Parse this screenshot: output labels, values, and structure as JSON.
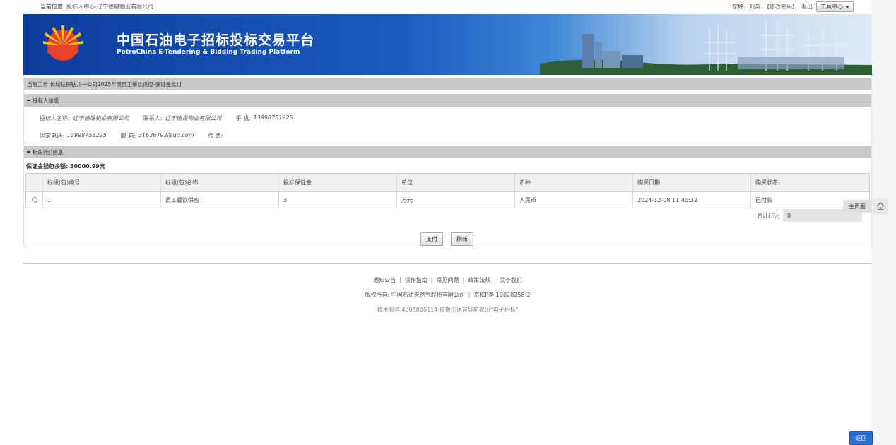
{
  "topbar": {
    "location_label": "当前位置:",
    "location_value": "投标人中心-辽宁德晟物业有限公司",
    "greeting_label": "您好:",
    "user_name": "刘英",
    "change_password": "【修改密码】",
    "logout": "退出",
    "tool_center": "工具中心"
  },
  "banner": {
    "title_cn": "中国石油电子招标投标交易平台",
    "title_en": "PetroChina E-Tendering & Bidding Trading Platform"
  },
  "current_work": {
    "label": "当前工作",
    "value": "长城钻探钻井一公司2025年度员工餐饮供应-保证金支付"
  },
  "bidder_section": {
    "title": "投标人信息",
    "name_label": "投标人名称:",
    "name_value": "辽宁德晟物业有限公司",
    "contact_label": "联系人:",
    "contact_value": "辽宁德晟物业有限公司",
    "mobile_label": "手 机:",
    "mobile_value": "13998751225",
    "phone_label": "固定电话:",
    "phone_value": "13998751225",
    "email_label": "邮 箱:",
    "email_value": "31636792@qq.com",
    "fax_label": "传 真:",
    "fax_value": ""
  },
  "lot_section": {
    "title": "标段(包)信息",
    "balance_text": "保证金钱包余额: 30000.99元",
    "columns": [
      "标段(包)编号",
      "标段(包)名称",
      "投标保证金",
      "单位",
      "币种",
      "购买日期",
      "购买状态"
    ],
    "rows": [
      [
        "1",
        "员工餐饮供应",
        "3",
        "万元",
        "人民币",
        "2024-12-08 11:40:32",
        "已付款"
      ]
    ],
    "total_label": "总计(元):",
    "total_value": "0"
  },
  "actions": {
    "pay": "支付",
    "refresh": "刷新"
  },
  "side": {
    "home_page": "主页面"
  },
  "footer": {
    "links": [
      "通知公告",
      "操作指南",
      "常见问题",
      "政策法规",
      "关于我们"
    ],
    "separator": "|",
    "copyright": "版权所有: 中国石油天然气股份有限公司",
    "icp": "京ICP备 10020258-2",
    "support": "技术服务:4008800114 按提示语音导航说出\"电子招标\""
  },
  "return_button": "返回",
  "colors": {
    "banner_blue": "#1b5cbf",
    "section_bar": "#c9c9c9",
    "return_button": "#2a6fd0"
  }
}
